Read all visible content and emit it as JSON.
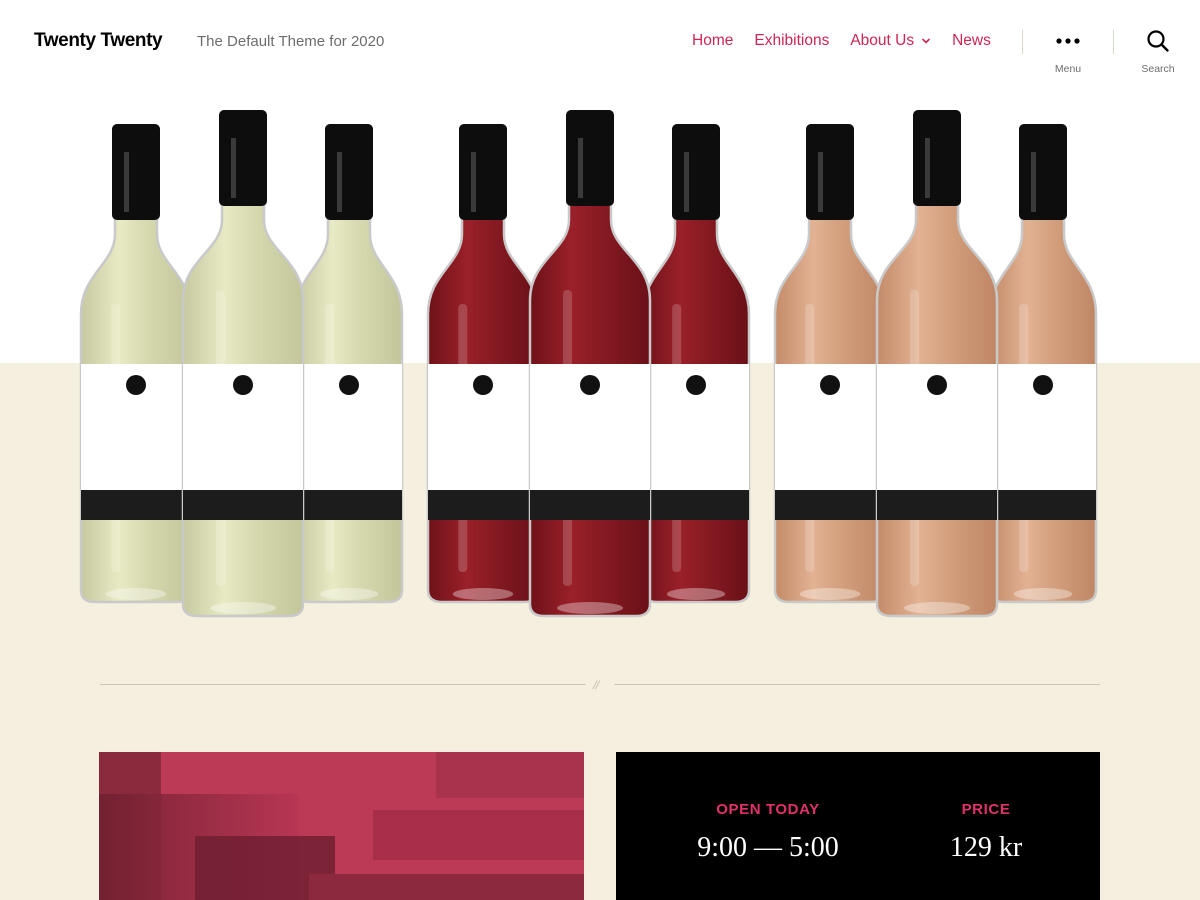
{
  "site": {
    "title": "Twenty Twenty",
    "description": "The Default Theme for 2020"
  },
  "nav": {
    "items": [
      {
        "label": "Home"
      },
      {
        "label": "Exhibitions"
      },
      {
        "label": "About Us",
        "has_dropdown": true
      },
      {
        "label": "News"
      }
    ],
    "menu_label": "Menu",
    "search_label": "Search"
  },
  "hero": {
    "wine_groups": [
      {
        "kind": "white",
        "color": "#dfe1b8"
      },
      {
        "kind": "red",
        "color": "#8b1a22"
      },
      {
        "kind": "rose",
        "color": "#d8a17f"
      }
    ]
  },
  "separator": {
    "mark": "//"
  },
  "info": {
    "open_heading": "OPEN TODAY",
    "open_value": "9:00 — 5:00",
    "price_heading": "PRICE",
    "price_value": "129 kr"
  },
  "colors": {
    "accent": "#cd2653",
    "hero_bottom_bg": "#f5efe0",
    "panel_dark": "#000000",
    "panel_pink": "#b63553"
  }
}
